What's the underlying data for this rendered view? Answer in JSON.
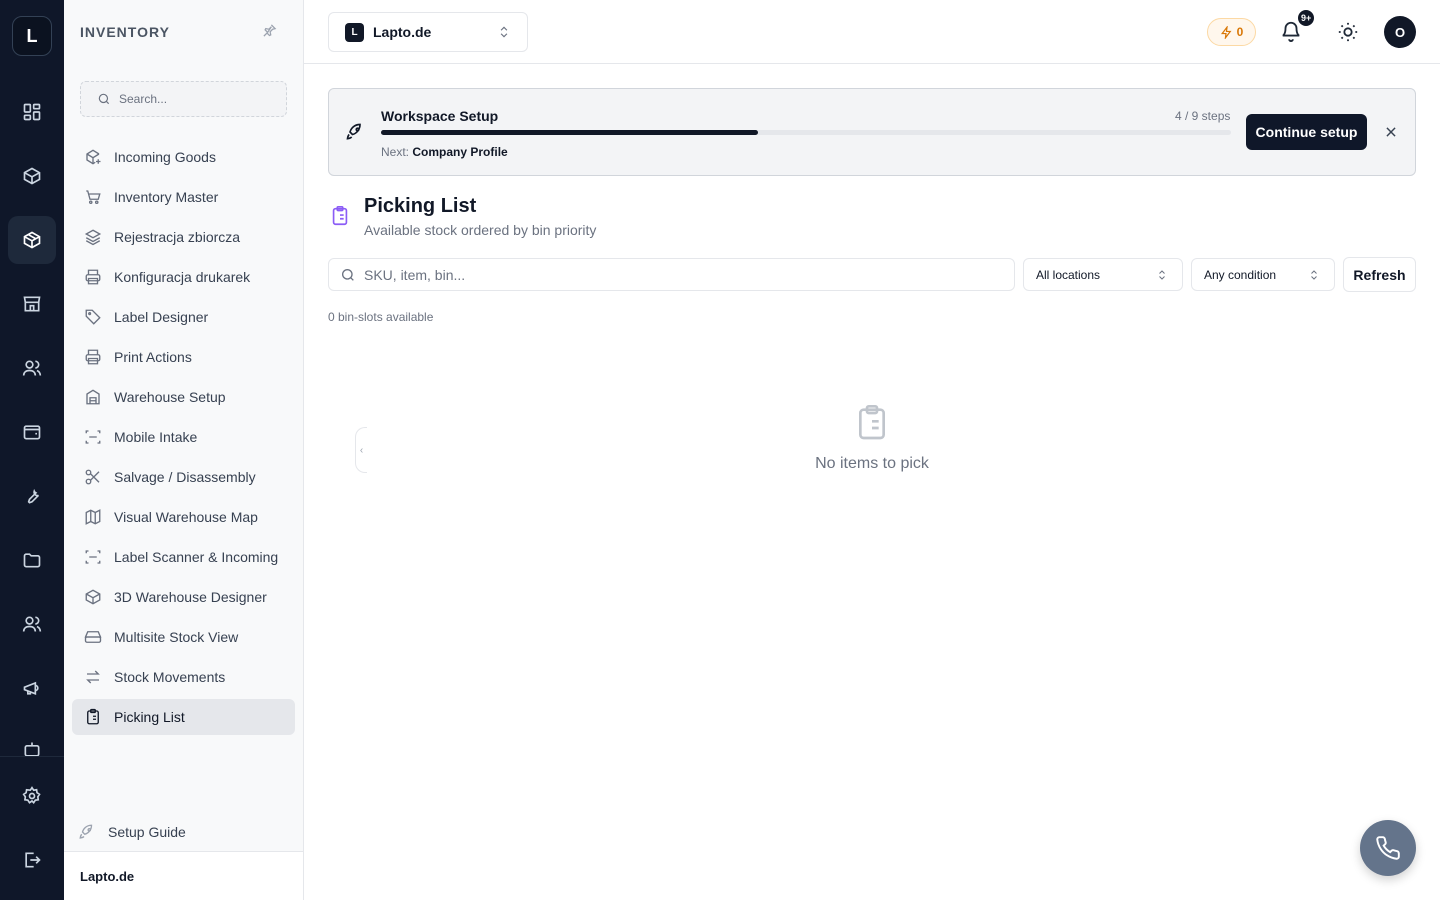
{
  "rail": {
    "logo_letter": "L",
    "icons": [
      "dashboard-icon",
      "package-icon",
      "inventory-box-icon",
      "store-icon",
      "users-icon",
      "wallet-icon",
      "wrench-icon",
      "folder-icon",
      "team-icon",
      "megaphone-icon",
      "bot-icon",
      "settings-icon",
      "logout-icon"
    ],
    "active": "inventory-box-icon"
  },
  "sidebar": {
    "title": "INVENTORY",
    "search_placeholder": "Search...",
    "items": [
      {
        "label": "Incoming Goods",
        "icon": "package-plus-icon"
      },
      {
        "label": "Inventory Master",
        "icon": "cart-icon"
      },
      {
        "label": "Rejestracja zbiorcza",
        "icon": "layers-icon"
      },
      {
        "label": "Konfiguracja drukarek",
        "icon": "printer-icon"
      },
      {
        "label": "Label Designer",
        "icon": "tag-icon"
      },
      {
        "label": "Print Actions",
        "icon": "printer-icon"
      },
      {
        "label": "Warehouse Setup",
        "icon": "building-icon"
      },
      {
        "label": "Mobile Intake",
        "icon": "scan-icon"
      },
      {
        "label": "Salvage / Disassembly",
        "icon": "scissors-icon"
      },
      {
        "label": "Visual Warehouse Map",
        "icon": "map-icon"
      },
      {
        "label": "Label Scanner & Incoming",
        "icon": "scan-icon"
      },
      {
        "label": "3D Warehouse Designer",
        "icon": "cube-icon"
      },
      {
        "label": "Multisite Stock View",
        "icon": "hard-drive-icon"
      },
      {
        "label": "Stock Movements",
        "icon": "arrows-icon"
      },
      {
        "label": "Picking List",
        "icon": "clipboard-list-icon",
        "active": true
      }
    ],
    "setup_guide": "Setup Guide",
    "footer": "Lapto.de"
  },
  "header": {
    "workspace_badge": "L",
    "workspace_name": "Lapto.de",
    "credits": "0",
    "notifications_badge": "9+",
    "avatar_letter": "O"
  },
  "setup_banner": {
    "title": "Workspace Setup",
    "steps_text": "4 / 9 steps",
    "progress_fraction": 0.444,
    "next_label": "Next:",
    "next_step": "Company Profile",
    "continue_label": "Continue setup"
  },
  "page": {
    "title": "Picking List",
    "subtitle": "Available stock ordered by bin priority",
    "search_placeholder": "SKU, item, bin...",
    "location_filter": "All locations",
    "condition_filter": "Any condition",
    "refresh_label": "Refresh",
    "count_text": "0 bin-slots available",
    "empty_text": "No items to pick"
  },
  "colors": {
    "rail_bg": "#0f1729",
    "accent_dark": "#0f1729",
    "page_icon": "#8b5cf6",
    "credits_amber": "#d97706",
    "fab": "#64748b"
  }
}
